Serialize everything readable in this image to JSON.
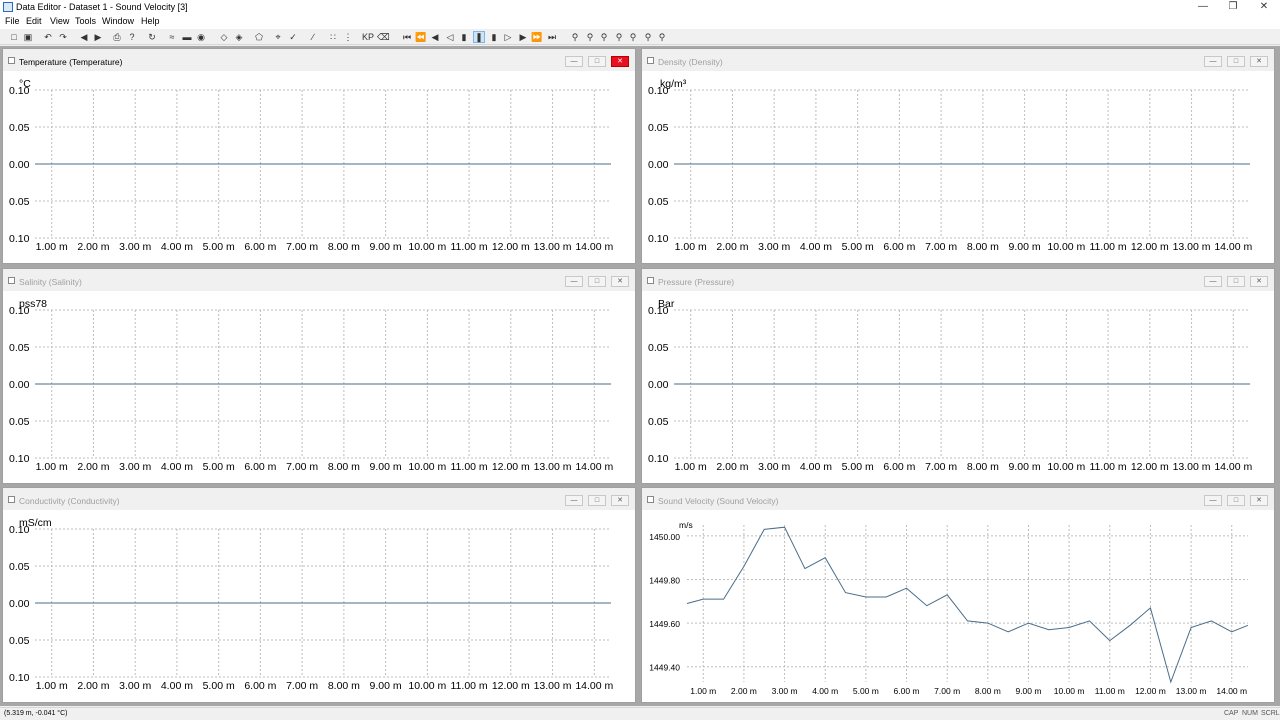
{
  "window": {
    "title": "Data Editor - Dataset 1 - Sound Velocity [3]"
  },
  "menu": [
    "File",
    "Edit",
    "View",
    "Tools",
    "Window",
    "Help"
  ],
  "toolbar": {
    "extra_label": "KP"
  },
  "x_ticks": [
    "1.00 m",
    "2.00 m",
    "3.00 m",
    "4.00 m",
    "5.00 m",
    "6.00 m",
    "7.00 m",
    "8.00 m",
    "9.00 m",
    "10.00 m",
    "11.00 m",
    "12.00 m",
    "13.00 m",
    "14.00 m"
  ],
  "panels": [
    {
      "title": "Temperature (Temperature)",
      "unit": "°C",
      "active": true,
      "y_ticks": [
        "0.10",
        "0.05",
        "0.00",
        "0.05",
        "0.10"
      ]
    },
    {
      "title": "Density (Density)",
      "unit": "kg/m³",
      "active": false,
      "y_ticks": [
        "0.10",
        "0.05",
        "0.00",
        "0.05",
        "0.10"
      ]
    },
    {
      "title": "Salinity (Salinity)",
      "unit": "pss78",
      "active": false,
      "y_ticks": [
        "0.10",
        "0.05",
        "0.00",
        "0.05",
        "0.10"
      ]
    },
    {
      "title": "Pressure (Pressure)",
      "unit": "Bar",
      "active": false,
      "y_ticks": [
        "0.10",
        "0.05",
        "0.00",
        "0.05",
        "0.10"
      ]
    },
    {
      "title": "Conductivity (Conductivity)",
      "unit": "mS/cm",
      "active": false,
      "y_ticks": [
        "0.10",
        "0.05",
        "0.00",
        "0.05",
        "0.10"
      ]
    },
    {
      "title": "Sound Velocity (Sound Velocity)",
      "unit": "m/s",
      "active": false,
      "y_ticks": [
        "1450.00",
        "1449.80",
        "1449.60",
        "1449.40"
      ]
    }
  ],
  "chart_data": [
    {
      "type": "line",
      "title": "Temperature (Temperature)",
      "ylabel": "°C",
      "xlim": [
        0.6,
        14.4
      ],
      "ylim": [
        -0.1,
        0.1
      ],
      "series": [
        {
          "x": [
            0.6,
            14.4
          ],
          "y": [
            0,
            0
          ]
        }
      ]
    },
    {
      "type": "line",
      "title": "Density (Density)",
      "ylabel": "kg/m³",
      "xlim": [
        0.6,
        14.4
      ],
      "ylim": [
        -0.1,
        0.1
      ],
      "series": [
        {
          "x": [
            0.6,
            14.4
          ],
          "y": [
            0,
            0
          ]
        }
      ]
    },
    {
      "type": "line",
      "title": "Salinity (Salinity)",
      "ylabel": "pss78",
      "xlim": [
        0.6,
        14.4
      ],
      "ylim": [
        -0.1,
        0.1
      ],
      "series": [
        {
          "x": [
            0.6,
            14.4
          ],
          "y": [
            0,
            0
          ]
        }
      ]
    },
    {
      "type": "line",
      "title": "Pressure (Pressure)",
      "ylabel": "Bar",
      "xlim": [
        0.6,
        14.4
      ],
      "ylim": [
        -0.1,
        0.1
      ],
      "series": [
        {
          "x": [
            0.6,
            14.4
          ],
          "y": [
            0,
            0
          ]
        }
      ]
    },
    {
      "type": "line",
      "title": "Conductivity (Conductivity)",
      "ylabel": "mS/cm",
      "xlim": [
        0.6,
        14.4
      ],
      "ylim": [
        -0.1,
        0.1
      ],
      "series": [
        {
          "x": [
            0.6,
            14.4
          ],
          "y": [
            0,
            0
          ]
        }
      ]
    },
    {
      "type": "line",
      "title": "Sound Velocity (Sound Velocity)",
      "ylabel": "m/s",
      "xlim": [
        0.6,
        14.4
      ],
      "ylim": [
        1449.33,
        1450.05
      ],
      "series": [
        {
          "x": [
            0.6,
            1.0,
            1.5,
            2.0,
            2.5,
            3.0,
            3.5,
            4.0,
            4.5,
            5.0,
            5.5,
            6.0,
            6.5,
            7.0,
            7.5,
            8.0,
            8.5,
            9.0,
            9.5,
            10.0,
            10.5,
            11.0,
            11.5,
            12.0,
            12.5,
            13.0,
            13.5,
            14.0,
            14.4
          ],
          "y": [
            1449.69,
            1449.71,
            1449.71,
            1449.86,
            1450.03,
            1450.04,
            1449.85,
            1449.9,
            1449.74,
            1449.72,
            1449.72,
            1449.76,
            1449.68,
            1449.73,
            1449.61,
            1449.6,
            1449.56,
            1449.6,
            1449.57,
            1449.58,
            1449.61,
            1449.52,
            1449.59,
            1449.67,
            1449.33,
            1449.58,
            1449.61,
            1449.56,
            1449.59
          ]
        }
      ]
    }
  ],
  "status": {
    "coords": "(5.319 m, -0.041 °C)",
    "cap": "CAP",
    "num": "NUM",
    "scrl": "SCRL"
  }
}
